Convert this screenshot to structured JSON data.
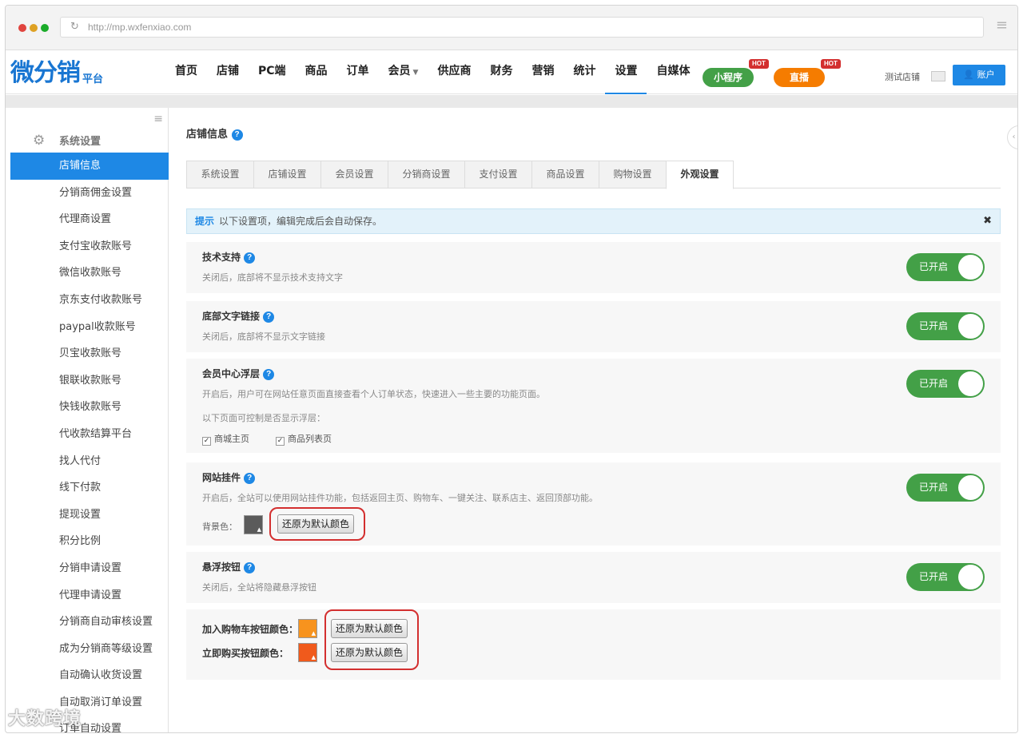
{
  "browser": {
    "url": "http://mp.wxfenxiao.com",
    "dots": [
      "#e0443e",
      "#dea123",
      "#1aab29"
    ]
  },
  "header": {
    "logo_main": "微分销",
    "logo_sub": "平台",
    "nav": [
      "首页",
      "店铺",
      "PC端",
      "商品",
      "订单",
      "会员",
      "供应商",
      "财务",
      "营销",
      "统计",
      "设置",
      "自媒体"
    ],
    "active_nav": "设置",
    "pill_mini": "小程序",
    "pill_live": "直播",
    "hot_badge": "HOT",
    "store_name": "测试店铺",
    "account": "账户"
  },
  "sidebar": {
    "heading": "系统设置",
    "items": [
      "店铺信息",
      "分销商佣金设置",
      "代理商设置",
      "支付宝收款账号",
      "微信收款账号",
      "京东支付收款账号",
      "paypal收款账号",
      "贝宝收款账号",
      "银联收款账号",
      "快钱收款账号",
      "代收款结算平台",
      "找人代付",
      "线下付款",
      "提现设置",
      "积分比例",
      "分销申请设置",
      "代理申请设置",
      "分销商自动审核设置",
      "成为分销商等级设置",
      "自动确认收货设置",
      "自动取消订单设置",
      "订单自动设置"
    ],
    "active_index": 0
  },
  "main": {
    "title": "店铺信息",
    "tabs": [
      "系统设置",
      "店铺设置",
      "会员设置",
      "分销商设置",
      "支付设置",
      "商品设置",
      "购物设置",
      "外观设置"
    ],
    "active_tab": 7,
    "tip_label": "提示",
    "tip_text": "以下设置项，编辑完成后会自动保存。",
    "toggle_on_label": "已开启",
    "cards": {
      "tech_support": {
        "title": "技术支持",
        "desc": "关闭后，底部将不显示技术支持文字",
        "enabled": true
      },
      "footer_link": {
        "title": "底部文字链接",
        "desc": "关闭后，底部将不显示文字链接",
        "enabled": true
      },
      "member_float": {
        "title": "会员中心浮层",
        "desc": "开启后，用户可在网站任意页面直接查看个人订单状态，快速进入一些主要的功能页面。",
        "subdesc": "以下页面可控制是否显示浮层：",
        "checkbox_home": "商城主页",
        "checkbox_list": "商品列表页",
        "home_checked": true,
        "list_checked": true,
        "enabled": true
      },
      "widget": {
        "title": "网站挂件",
        "desc": "开启后，全站可以使用网站挂件功能，包括返回主页、购物车、一键关注、联系店主、返回顶部功能。",
        "bg_label": "背景色：",
        "bg_color": "#5b5b5b",
        "reset_label": "还原为默认颜色",
        "enabled": true
      },
      "float_button": {
        "title": "悬浮按钮",
        "desc": "关闭后，全站将隐藏悬浮按钮",
        "enabled": true
      },
      "buttons": {
        "cart_label": "加入购物车按钮颜色：",
        "cart_color": "#f7931e",
        "buy_label": "立即购买按钮颜色：",
        "buy_color": "#f05a1c",
        "reset_label": "还原为默认颜色"
      }
    }
  },
  "watermark": "大数跨境"
}
